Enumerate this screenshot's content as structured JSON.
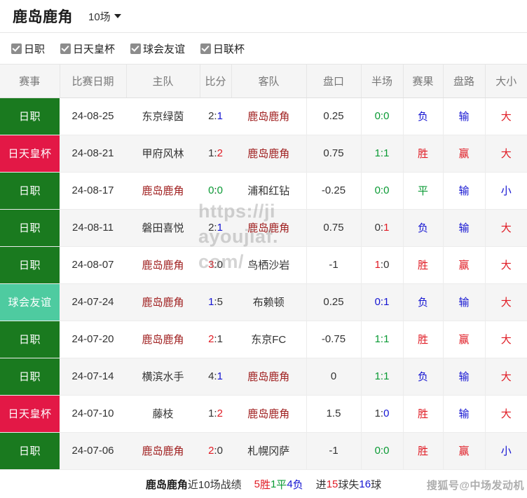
{
  "header": {
    "team_name": "鹿岛鹿角",
    "match_count_label": "10场",
    "caret_icon": "chevron-down-icon"
  },
  "filters": [
    {
      "label": "日职",
      "checked": true
    },
    {
      "label": "日天皇杯",
      "checked": true
    },
    {
      "label": "球会友谊",
      "checked": true
    },
    {
      "label": "日联杯",
      "checked": true
    }
  ],
  "table": {
    "columns": [
      "赛事",
      "比赛日期",
      "主队",
      "比分",
      "客队",
      "盘口",
      "半场",
      "赛果",
      "盘路",
      "大小"
    ],
    "highlight_team": "鹿岛鹿角",
    "league_colors": {
      "日职": "#1a7a1f",
      "日天皇杯": "#e31846",
      "球会友谊": "#4ecba0"
    },
    "rows": [
      {
        "league": "日职",
        "league_color": "#1a7a1f",
        "date": "24-08-25",
        "home": "东京绿茵",
        "home_hl": false,
        "score_home": "2",
        "score_home_color": "dark",
        "score_away": "1",
        "score_away_color": "blue",
        "away": "鹿岛鹿角",
        "away_hl": true,
        "handicap": "0.25",
        "handicap_color": "dark",
        "half": "0:0",
        "half_color": "green",
        "result": "负",
        "result_color": "blue",
        "road": "输",
        "road_color": "blue",
        "size": "大",
        "size_color": "red"
      },
      {
        "league": "日天皇杯",
        "league_color": "#e31846",
        "date": "24-08-21",
        "home": "甲府风林",
        "home_hl": false,
        "score_home": "1",
        "score_home_color": "dark",
        "score_away": "2",
        "score_away_color": "red",
        "away": "鹿岛鹿角",
        "away_hl": true,
        "handicap": "0.75",
        "handicap_color": "dark",
        "half": "1:1",
        "half_color": "green",
        "result": "胜",
        "result_color": "red",
        "road": "赢",
        "road_color": "red",
        "size": "大",
        "size_color": "red"
      },
      {
        "league": "日职",
        "league_color": "#1a7a1f",
        "date": "24-08-17",
        "home": "鹿岛鹿角",
        "home_hl": true,
        "score_home": "0",
        "score_home_color": "green",
        "score_away": "0",
        "score_away_color": "green",
        "away": "浦和红钻",
        "away_hl": false,
        "handicap": "-0.25",
        "handicap_color": "dark",
        "half": "0:0",
        "half_color": "green",
        "result": "平",
        "result_color": "green",
        "road": "输",
        "road_color": "blue",
        "size": "小",
        "size_color": "blue"
      },
      {
        "league": "日职",
        "league_color": "#1a7a1f",
        "date": "24-08-11",
        "home": "磐田喜悦",
        "home_hl": false,
        "score_home": "2",
        "score_home_color": "dark",
        "score_away": "1",
        "score_away_color": "blue",
        "away": "鹿岛鹿角",
        "away_hl": true,
        "handicap": "0.75",
        "handicap_color": "dark",
        "half": "0:1",
        "half_color": "mixed-0-1",
        "result": "负",
        "result_color": "blue",
        "road": "输",
        "road_color": "blue",
        "size": "大",
        "size_color": "red"
      },
      {
        "league": "日职",
        "league_color": "#1a7a1f",
        "date": "24-08-07",
        "home": "鹿岛鹿角",
        "home_hl": true,
        "score_home": "3",
        "score_home_color": "red",
        "score_away": "0",
        "score_away_color": "dark",
        "away": "鸟栖沙岩",
        "away_hl": false,
        "handicap": "-1",
        "handicap_color": "dark",
        "half": "1:0",
        "half_color": "mixed-1-0",
        "result": "胜",
        "result_color": "red",
        "road": "赢",
        "road_color": "red",
        "size": "大",
        "size_color": "red"
      },
      {
        "league": "球会友谊",
        "league_color": "#4ecba0",
        "date": "24-07-24",
        "home": "鹿岛鹿角",
        "home_hl": true,
        "score_home": "1",
        "score_home_color": "blue",
        "score_away": "5",
        "score_away_color": "dark",
        "away": "布赖顿",
        "away_hl": false,
        "handicap": "0.25",
        "handicap_color": "dark",
        "half": "0:1",
        "half_color": "blue",
        "result": "负",
        "result_color": "blue",
        "road": "输",
        "road_color": "blue",
        "size": "大",
        "size_color": "red"
      },
      {
        "league": "日职",
        "league_color": "#1a7a1f",
        "date": "24-07-20",
        "home": "鹿岛鹿角",
        "home_hl": true,
        "score_home": "2",
        "score_home_color": "red",
        "score_away": "1",
        "score_away_color": "dark",
        "away": "东京FC",
        "away_hl": false,
        "handicap": "-0.75",
        "handicap_color": "dark",
        "half": "1:1",
        "half_color": "green",
        "result": "胜",
        "result_color": "red",
        "road": "赢",
        "road_color": "red",
        "size": "大",
        "size_color": "red"
      },
      {
        "league": "日职",
        "league_color": "#1a7a1f",
        "date": "24-07-14",
        "home": "横滨水手",
        "home_hl": false,
        "score_home": "4",
        "score_home_color": "dark",
        "score_away": "1",
        "score_away_color": "blue",
        "away": "鹿岛鹿角",
        "away_hl": true,
        "handicap": "0",
        "handicap_color": "dark",
        "half": "1:1",
        "half_color": "green",
        "result": "负",
        "result_color": "blue",
        "road": "输",
        "road_color": "blue",
        "size": "大",
        "size_color": "red"
      },
      {
        "league": "日天皇杯",
        "league_color": "#e31846",
        "date": "24-07-10",
        "home": "藤枝",
        "home_hl": false,
        "score_home": "1",
        "score_home_color": "dark",
        "score_away": "2",
        "score_away_color": "red",
        "away": "鹿岛鹿角",
        "away_hl": true,
        "handicap": "1.5",
        "handicap_color": "dark",
        "half": "1:0",
        "half_color": "mixed-1-0b",
        "result": "胜",
        "result_color": "red",
        "road": "输",
        "road_color": "blue",
        "size": "大",
        "size_color": "red"
      },
      {
        "league": "日职",
        "league_color": "#1a7a1f",
        "date": "24-07-06",
        "home": "鹿岛鹿角",
        "home_hl": true,
        "score_home": "2",
        "score_home_color": "red",
        "score_away": "0",
        "score_away_color": "dark",
        "away": "札幌冈萨",
        "away_hl": false,
        "handicap": "-1",
        "handicap_color": "dark",
        "half": "0:0",
        "half_color": "green",
        "result": "胜",
        "result_color": "red",
        "road": "赢",
        "road_color": "red",
        "size": "小",
        "size_color": "blue"
      }
    ]
  },
  "footer": {
    "team": "鹿岛鹿角",
    "prefix": "近10场战绩",
    "wins": "5",
    "wins_label": "胜",
    "draws": "1",
    "draws_label": "平",
    "losses": "4",
    "losses_label": "负",
    "goals_for_label": "进",
    "goals_for": "15",
    "goals_for_suffix": "球",
    "goals_against_label": "失",
    "goals_against": "16",
    "goals_against_suffix": "球"
  },
  "watermarks": {
    "center_line1": "https://ji",
    "center_line2": "ayoujiaf.",
    "center_line3": "com/",
    "corner": "搜狐号@中场发动机"
  }
}
